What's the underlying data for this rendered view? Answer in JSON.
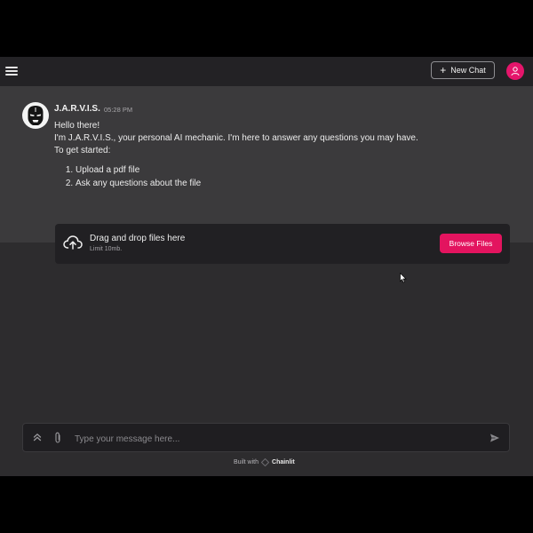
{
  "header": {
    "new_chat_label": "New Chat"
  },
  "message": {
    "author": "J.A.R.V.I.S.",
    "time": "05:28 PM",
    "lines": [
      "Hello there!",
      "I'm J.A.R.V.I.S., your personal AI mechanic. I'm here to answer any questions you may have.",
      "To get started:"
    ],
    "steps": [
      "Upload a pdf file",
      "Ask any questions about the file"
    ]
  },
  "upload": {
    "title": "Drag and drop files here",
    "limit": "Limit 10mb.",
    "browse_label": "Browse Files"
  },
  "composer": {
    "placeholder": "Type your message here..."
  },
  "footer": {
    "built_with": "Built with",
    "brand": "Chainlit"
  },
  "colors": {
    "accent": "#e3145f",
    "background": "#2d2c2e",
    "header_bg": "#232225",
    "message_bg": "#3b3a3c"
  },
  "icons": [
    "menu-icon",
    "plus-icon",
    "user-icon",
    "iron-man-icon",
    "upload-cloud-icon",
    "chevrons-up-icon",
    "paperclip-icon",
    "send-icon",
    "chainlit-logo-icon",
    "mouse-cursor-icon"
  ]
}
